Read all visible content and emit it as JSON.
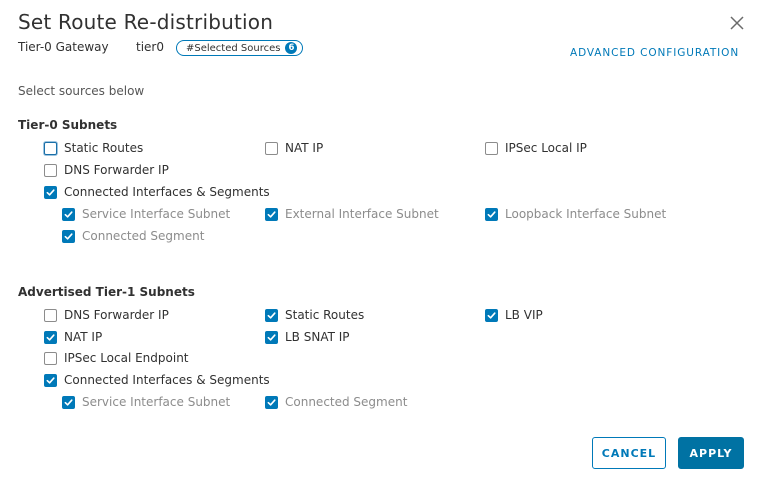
{
  "header": {
    "title": "Set Route Re-distribution",
    "gateway_type": "Tier-0 Gateway",
    "gateway_name": "tier0",
    "pill_label": "#Selected Sources",
    "pill_count": "6",
    "advanced_link": "ADVANCED CONFIGURATION"
  },
  "hint": "Select sources below",
  "tier0": {
    "title": "Tier-0 Subnets",
    "static_routes": {
      "label": "Static Routes",
      "checked": false
    },
    "nat_ip": {
      "label": "NAT IP",
      "checked": false
    },
    "ipsec_local_ip": {
      "label": "IPSec Local IP",
      "checked": false
    },
    "dns_forwarder_ip": {
      "label": "DNS Forwarder IP",
      "checked": false
    },
    "connected_if": {
      "label": "Connected Interfaces & Segments",
      "checked": true
    },
    "service_if_subnet": {
      "label": "Service Interface Subnet",
      "checked": true
    },
    "external_if_subnet": {
      "label": "External Interface Subnet",
      "checked": true
    },
    "loopback_if_subnet": {
      "label": "Loopback Interface Subnet",
      "checked": true
    },
    "connected_segment": {
      "label": "Connected Segment",
      "checked": true
    }
  },
  "tier1": {
    "title": "Advertised Tier-1 Subnets",
    "dns_forwarder_ip": {
      "label": "DNS Forwarder IP",
      "checked": false
    },
    "static_routes": {
      "label": "Static Routes",
      "checked": true
    },
    "lb_vip": {
      "label": "LB VIP",
      "checked": true
    },
    "nat_ip": {
      "label": "NAT IP",
      "checked": true
    },
    "lb_snat_ip": {
      "label": "LB SNAT IP",
      "checked": true
    },
    "ipsec_local_endpoint": {
      "label": "IPSec Local Endpoint",
      "checked": false
    },
    "connected_if": {
      "label": "Connected Interfaces & Segments",
      "checked": true
    },
    "service_if_subnet": {
      "label": "Service Interface Subnet",
      "checked": true
    },
    "connected_segment": {
      "label": "Connected Segment",
      "checked": true
    }
  },
  "buttons": {
    "cancel": "CANCEL",
    "apply": "APPLY"
  },
  "colors": {
    "accent": "#0079b8",
    "apply_bg": "#0072a3",
    "text": "#313131",
    "muted": "#8c8c8c"
  }
}
